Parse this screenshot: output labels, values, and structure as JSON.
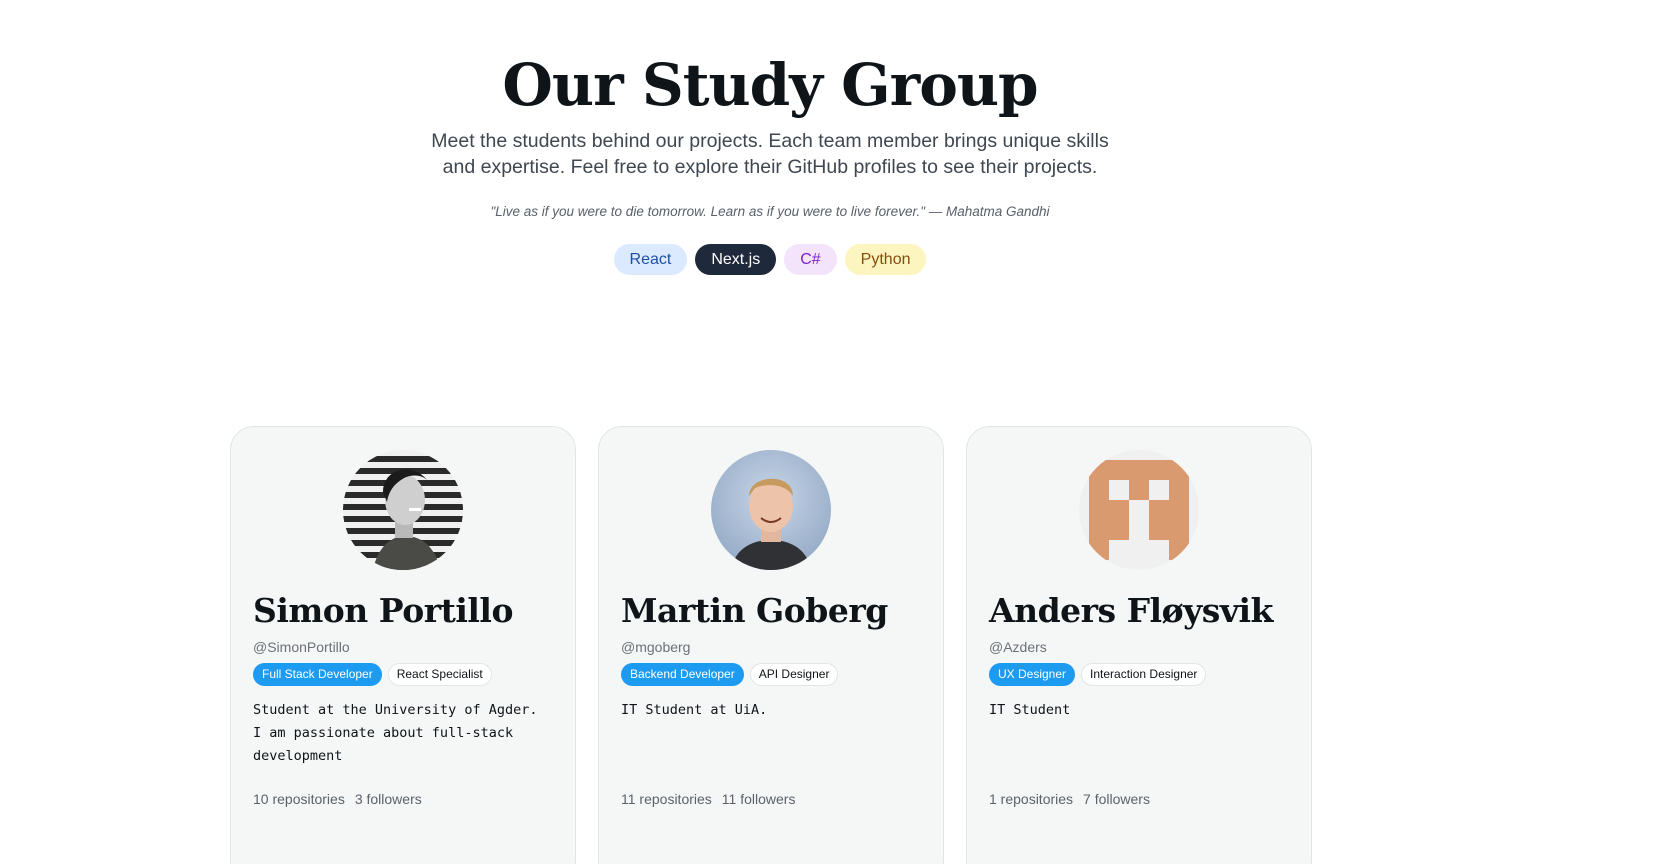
{
  "header": {
    "title": "Our Study Group",
    "subtitle": "Meet the students behind our projects. Each team member brings unique skills and expertise. Feel free to explore their GitHub profiles to see their projects.",
    "quote": "\"Live as if you were to die tomorrow. Learn as if you were to live forever.\" — Mahatma Gandhi"
  },
  "tech_tags": [
    {
      "label": "React",
      "color": "#dbeafe"
    },
    {
      "label": "Next.js",
      "color": "#1e293b"
    },
    {
      "label": "C#",
      "color": "#f3e3fb"
    },
    {
      "label": "Python",
      "color": "#fdf5bf"
    }
  ],
  "members": [
    {
      "name": "Simon Portillo",
      "handle": "@SimonPortillo",
      "role_primary": "Full Stack Developer",
      "role_secondary": "React Specialist",
      "bio": "Student at the University of Agder. I am passionate about full-stack development",
      "repos": "10 repositories",
      "followers": "3 followers"
    },
    {
      "name": "Martin Goberg",
      "handle": "@mgoberg",
      "role_primary": "Backend Developer",
      "role_secondary": "API Designer",
      "bio": "IT Student at UiA.",
      "repos": "11 repositories",
      "followers": "11 followers"
    },
    {
      "name": "Anders Fløysvik",
      "handle": "@Azders",
      "role_primary": "UX Designer",
      "role_secondary": "Interaction Designer",
      "bio": "IT Student",
      "repos": "1 repositories",
      "followers": "7 followers"
    }
  ],
  "colors": {
    "accent": "#1d9bf0",
    "card_bg": "#f5f7f7",
    "identicon": "#d99a70"
  }
}
